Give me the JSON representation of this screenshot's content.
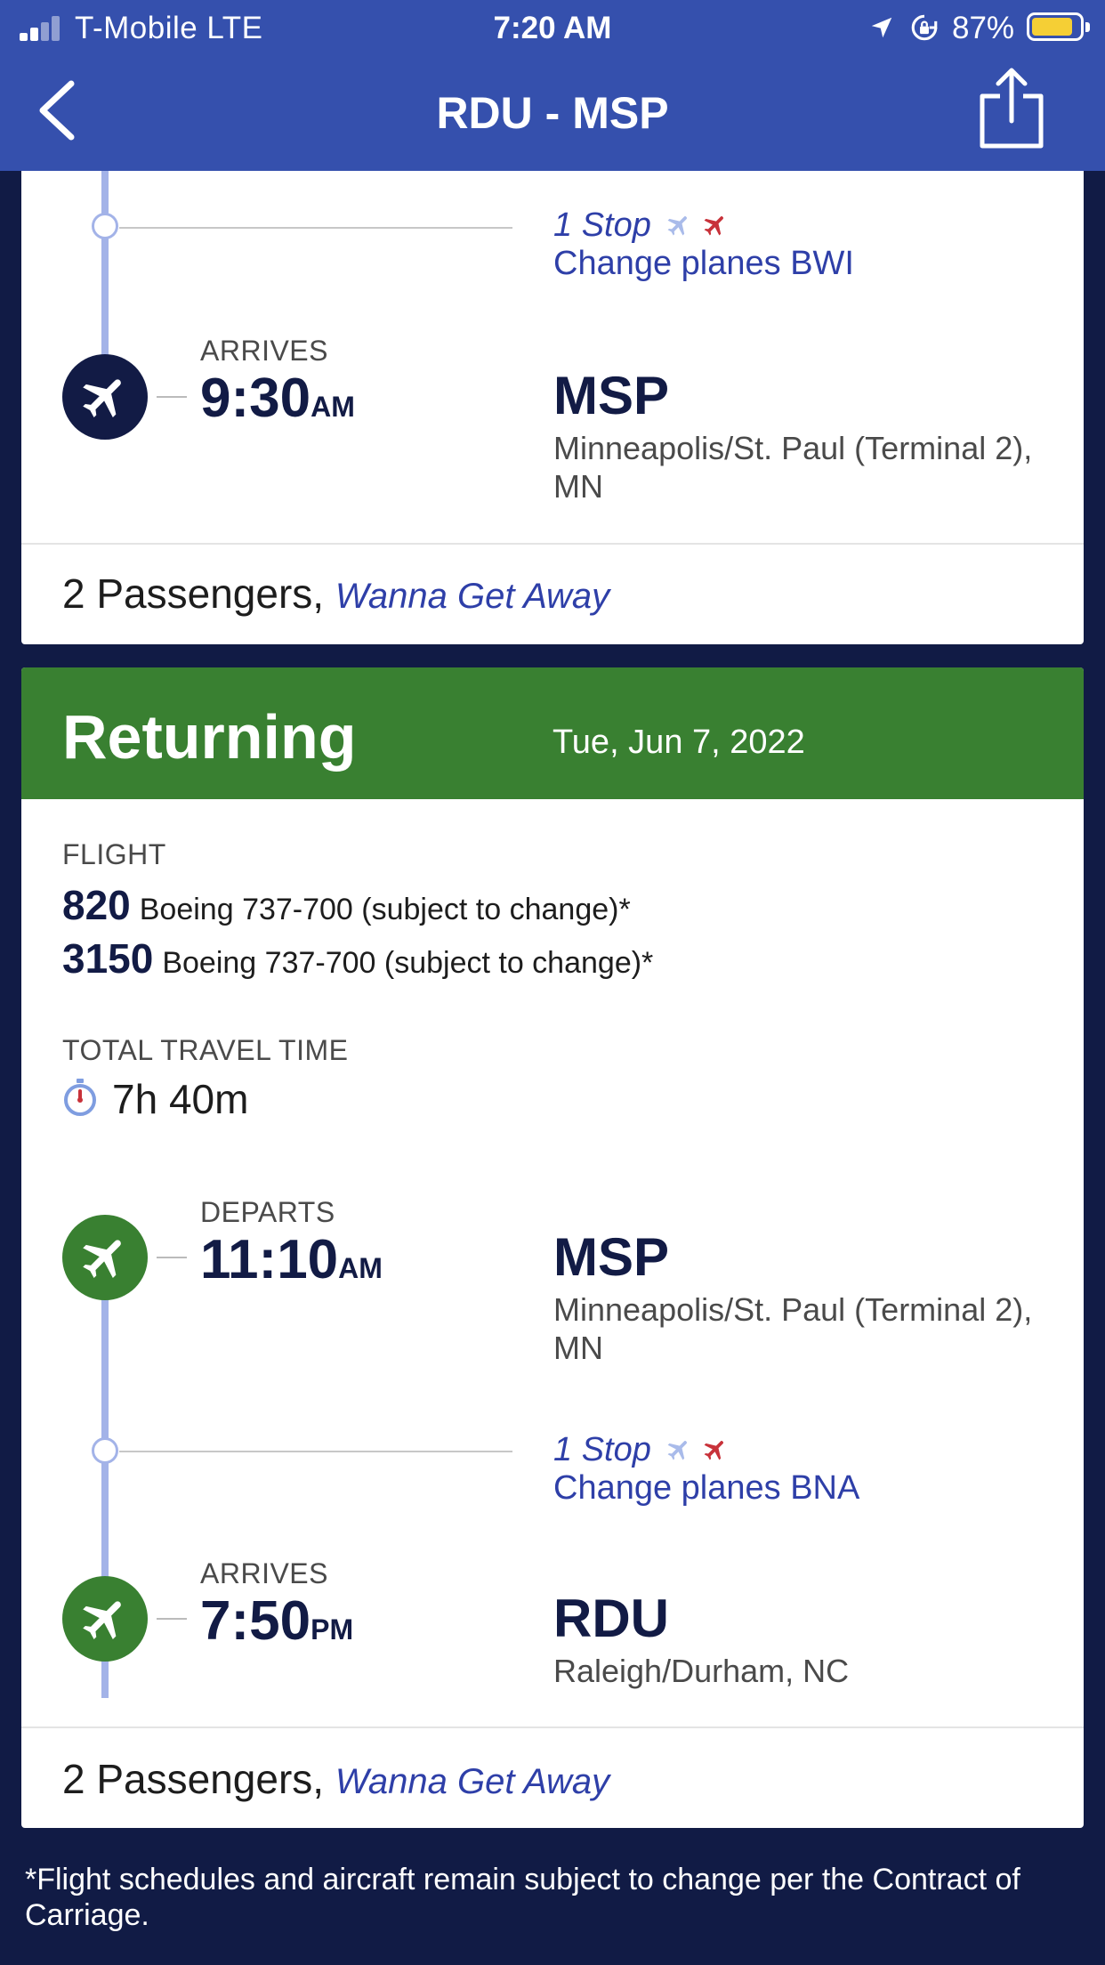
{
  "status_bar": {
    "carrier": "T-Mobile  LTE",
    "time": "7:20 AM",
    "battery_percent": "87%",
    "battery_level": 0.87,
    "battery_color": "#f5cf35"
  },
  "nav": {
    "title": "RDU - MSP",
    "back_icon": "chevron-left-icon",
    "share_icon": "share-icon"
  },
  "outbound": {
    "stop": {
      "count": "1 Stop",
      "change": "Change planes BWI"
    },
    "arrival": {
      "label": "ARRIVES",
      "time": "9:30",
      "ampm": "AM",
      "code": "MSP",
      "airport": "Minneapolis/St. Paul (Terminal 2), MN"
    },
    "passengers": "2 Passengers,",
    "fare": "Wanna Get Away",
    "plane_color": "#121b45"
  },
  "returning": {
    "header": "Returning",
    "date": "Tue, Jun 7, 2022",
    "header_color": "#398031",
    "flight_label": "FLIGHT",
    "flights": [
      {
        "number": "820",
        "aircraft": "Boeing 737-700 (subject to change)*"
      },
      {
        "number": "3150",
        "aircraft": "Boeing 737-700 (subject to change)*"
      }
    ],
    "travel_time_label": "TOTAL TRAVEL TIME",
    "travel_time": "7h 40m",
    "departure": {
      "label": "DEPARTS",
      "time": "11:10",
      "ampm": "AM",
      "code": "MSP",
      "airport": "Minneapolis/St. Paul (Terminal 2), MN"
    },
    "stop": {
      "count": "1 Stop",
      "change": "Change planes BNA"
    },
    "arrival": {
      "label": "ARRIVES",
      "time": "7:50",
      "ampm": "PM",
      "code": "RDU",
      "airport": "Raleigh/Durham, NC"
    },
    "passengers": "2 Passengers,",
    "fare": "Wanna Get Away"
  },
  "footnote": "*Flight schedules and aircraft remain subject to change per the Contract of Carriage."
}
